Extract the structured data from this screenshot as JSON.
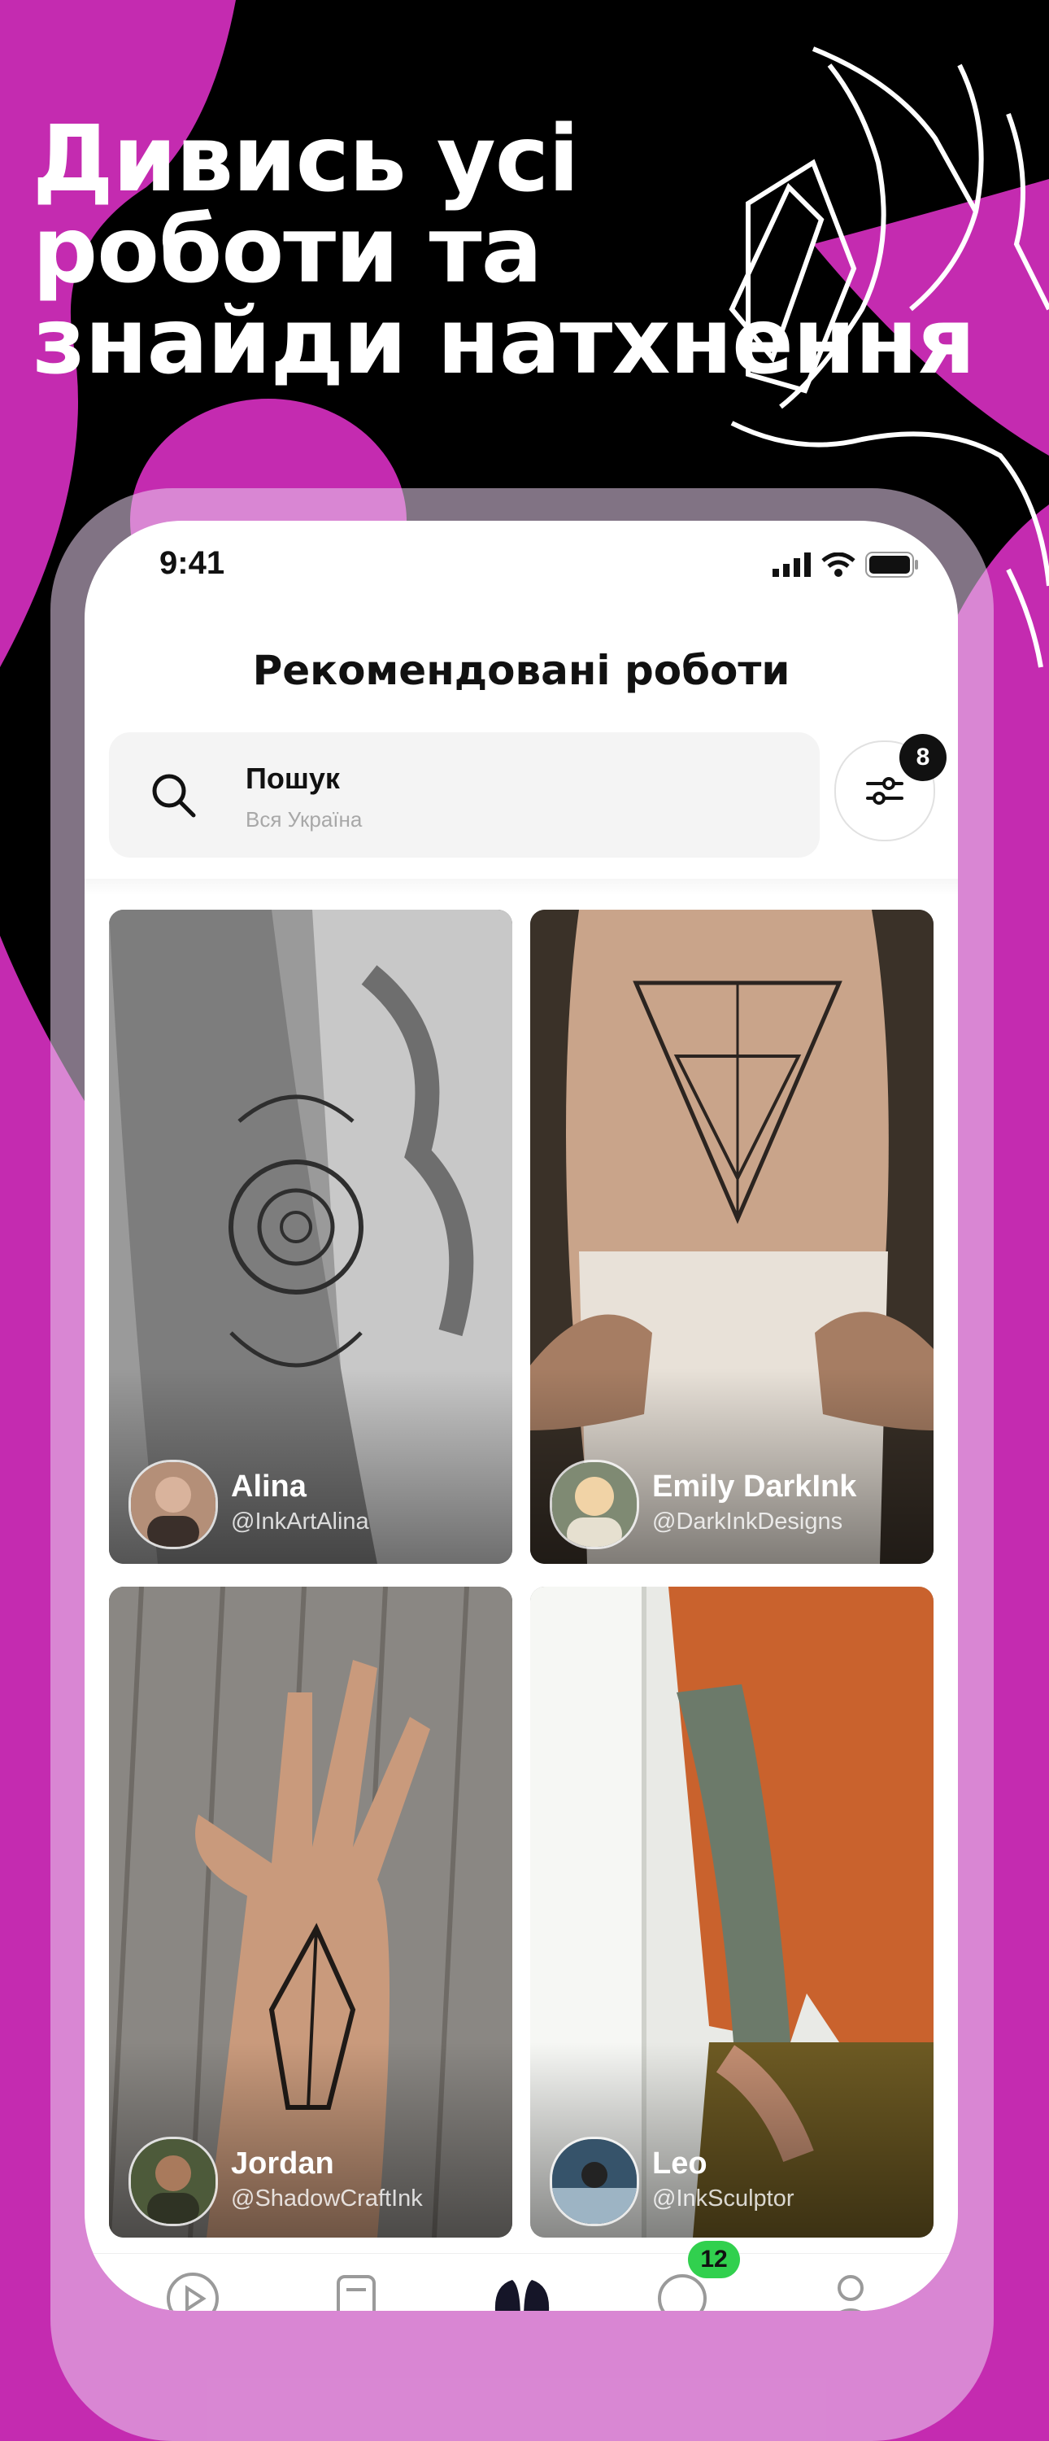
{
  "headline": {
    "lines": [
      "Дивись усі",
      "роботи та",
      "знайди натхнення"
    ]
  },
  "colors": {
    "magenta": "#c42bb0",
    "black": "#000000",
    "accent_green": "#31d04e"
  },
  "status_bar": {
    "time": "9:41",
    "icons": [
      "cellular-icon",
      "wifi-icon",
      "battery-icon"
    ]
  },
  "header": {
    "title": "Рекомендовані роботи"
  },
  "search": {
    "label": "Пошук",
    "location": "Вся Україна",
    "icon": "search-icon"
  },
  "filter": {
    "icon": "sliders-icon",
    "count": "8"
  },
  "cards": [
    {
      "name": "Alina",
      "handle": "@InkArtAlina"
    },
    {
      "name": "Emily DarkInk",
      "handle": "@DarkInkDesigns"
    },
    {
      "name": "Jordan",
      "handle": "@ShadowCraftInk"
    },
    {
      "name": "Leo",
      "handle": "@InkSculptor"
    }
  ],
  "tabbar": {
    "items": [
      "play-icon",
      "document-icon",
      "works-icon",
      "messages-icon",
      "profile-icon"
    ],
    "messages_badge": "12"
  }
}
